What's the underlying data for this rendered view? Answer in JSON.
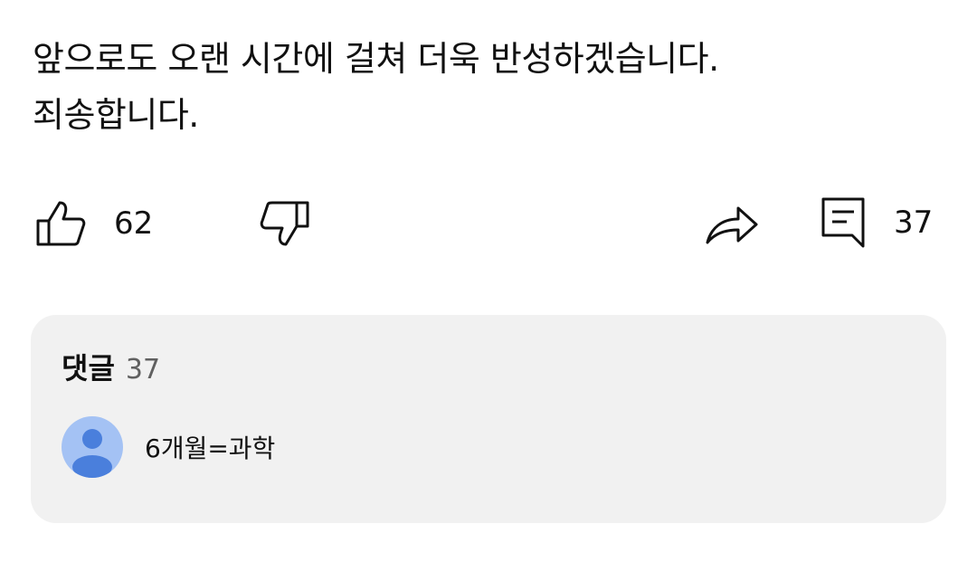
{
  "post": {
    "lines": [
      "앞으로도 오랜 시간에 걸쳐 더욱 반성하겠습니다.",
      "죄송합니다."
    ]
  },
  "actions": {
    "like_icon": "thumb-up-icon",
    "like_count": "62",
    "dislike_icon": "thumb-down-icon",
    "share_icon": "share-icon",
    "comment_icon": "comment-icon",
    "comment_count": "37"
  },
  "comments": {
    "title": "댓글",
    "count": "37",
    "preview": {
      "avatar_icon": "default-avatar-icon",
      "text": "6개월=과학"
    }
  },
  "colors": {
    "background": "#ffffff",
    "card": "#f1f1f1",
    "avatar_bg": "#a4c2f4",
    "avatar_fg": "#4a7fdc"
  }
}
